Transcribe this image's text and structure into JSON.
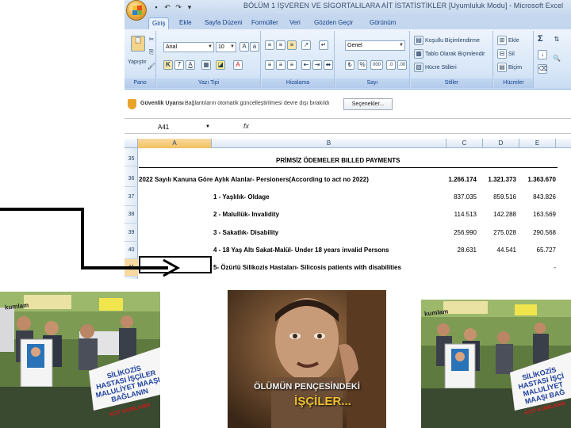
{
  "excel": {
    "title": "BÖLÜM 1 İŞVEREN VE SİGORTALILARA AİT İSTATİSTİKLER [Uyumluluk Modu] - Microsoft Excel",
    "tabs": [
      "Giriş",
      "Ekle",
      "Sayfa Düzeni",
      "Formüller",
      "Veri",
      "Gözden Geçir",
      "Görünüm"
    ],
    "active_tab": "Giriş",
    "ribbon": {
      "paste_label": "Yapıştır",
      "clipboard_label": "Pano",
      "font_name": "Arial",
      "font_size": "10",
      "bold": "K",
      "italic": "T",
      "underline": "A",
      "font_group_label": "Yazı Tipi",
      "alignment_label": "Hizalama",
      "number_format": "Genel",
      "number_group_label": "Sayı",
      "percent": "%",
      "thousands": "000",
      "cond_format": "Koşullu Biçimlendirme",
      "table_format": "Tablo Olarak Biçimlendir",
      "cell_styles": "Hücre Stilleri",
      "styles_label": "Stiller",
      "insert": "Ekle",
      "delete": "Sil",
      "format": "Biçim",
      "cells_label": "Hücreler",
      "sigma": "Σ"
    },
    "security": {
      "title": "Güvenlik Uyarısı",
      "message": "Bağlantıların otomatik güncelleştirilmesi devre dışı bırakıldı",
      "button": "Seçenekler..."
    },
    "formula_bar": {
      "name_box": "A41",
      "fx": "fx"
    },
    "columns": [
      "A",
      "B",
      "C",
      "D",
      "E"
    ],
    "rows": [
      {
        "num": "35",
        "label": "PRİMSİZ ÖDEMELER BILLED PAYMENTS",
        "c": "",
        "d": "",
        "e": ""
      },
      {
        "num": "36",
        "label": "2022 Sayılı Kanuna Göre Aylık Alanlar- Persioners(According to act no 2022)",
        "c": "1.266.174",
        "d": "1.321.373",
        "e": "1.363.670"
      },
      {
        "num": "37",
        "label": "1 - Yaşlılık- Oldage",
        "c": "837.035",
        "d": "859.516",
        "e": "843.826"
      },
      {
        "num": "38",
        "label": "2 - Malullük- Invalidity",
        "c": "114.513",
        "d": "142.288",
        "e": "163.569"
      },
      {
        "num": "39",
        "label": "3 - Sakatlık- Disability",
        "c": "256.990",
        "d": "275.028",
        "e": "290.568"
      },
      {
        "num": "40",
        "label": "4 - 18 Yaş Altı Sakat-Malül- Under 18 years invalid Persons",
        "c": "28.631",
        "d": "44.541",
        "e": "65.727"
      },
      {
        "num": "41",
        "label": "5- Özürlü Silikozis Hastaları- Silicosis patients with disabilities",
        "c": "",
        "d": "",
        "e": "-"
      }
    ]
  },
  "photos": {
    "left_banner": "SİLİKOZİS HASTASI İŞÇİLER MALULİYET MAAŞI BAĞLANIN",
    "left_banner_sub": "KOT KUMLAMA",
    "left_sign_top": "kumlam",
    "center_caption_1": "ÖLÜMÜN PENÇESİNDEKİ",
    "center_caption_2": "İŞÇİLER...",
    "right_banner": "SİLİKOZİS HASTASI İŞÇİ MALULİYET MAAŞI BAĞ",
    "right_banner_sub": "KOT KUMLAMA",
    "right_sign_top": "kumlam"
  },
  "colors": {
    "ribbon": "#d7e6f7",
    "title": "#c5d7ee",
    "arrow": "#000000"
  }
}
